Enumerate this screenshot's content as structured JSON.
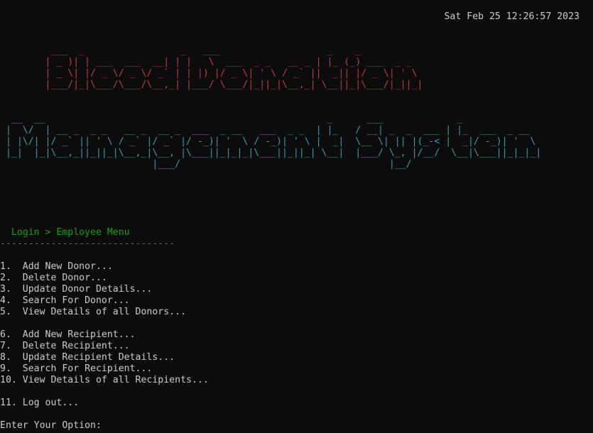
{
  "header": {
    "timestamp": "Sat Feb 25 12:26:57 2023"
  },
  "banner": {
    "title_line1": "Blood Donation",
    "title_line2": "Management System",
    "line1_art": "         ___  _                 _   ___                   _    _\n        | _ )| | ___  ___  __| | |   \\  ___  _ _   __ _ | |_ (_) ___  _ _\n        | _ \\| |/ _ \\/ _ \\/ _` | | |) |/ _ \\| ' \\ / _` ||  _|| |/ _ \\| ' \\\n        |___/|_|\\___/\\___/\\__,_| |___/ \\___/|_||_|\\__,_| \\__||_|\\___/|_||_|\n",
    "line2_art": "  __  __                                                  _      ___             _\n |  \\/  | __ _  _ _   __ _  __ _  ___  _ __   ___  _ _  | |_   / __| _  _  ___ | |_  ___  _ __\n | |\\/| |/ _` || ' \\ / _` |/ _` |/ -_)| '  \\ / -_)| ' \\ |  _|  \\__ \\| || |(_-< |  _|/ -_)| '  \\\n |_|  |_|\\__,_||_||_|\\__,_|\\__, |\\___||_|_|_|\\___||_||_| \\__|  |___/ \\_, |/__/  \\__|\\___||_|_|_|\n                           |___/                                     |__/"
  },
  "navigation": {
    "breadcrumb": "  Login > Employee Menu",
    "divider": "-------------------------------"
  },
  "menu": {
    "donor_items": [
      "1.  Add New Donor...",
      "2.  Delete Donor...",
      "3.  Update Donor Details...",
      "4.  Search For Donor...",
      "5.  View Details of all Donors..."
    ],
    "recipient_items": [
      "6.  Add New Recipient...",
      "7.  Delete Recipient...",
      "8.  Update Recipient Details...",
      "9.  Search For Recipient...",
      "10. View Details of all Recipients..."
    ],
    "logout_item": "11. Log out..."
  },
  "prompt": {
    "label": "Enter Your Option: "
  },
  "colors": {
    "background": "#0c0c0c",
    "text": "#cccccc",
    "banner_red": "#c33b3b",
    "banner_cyan": "#3a9cb0",
    "breadcrumb_green": "#13a10e"
  }
}
